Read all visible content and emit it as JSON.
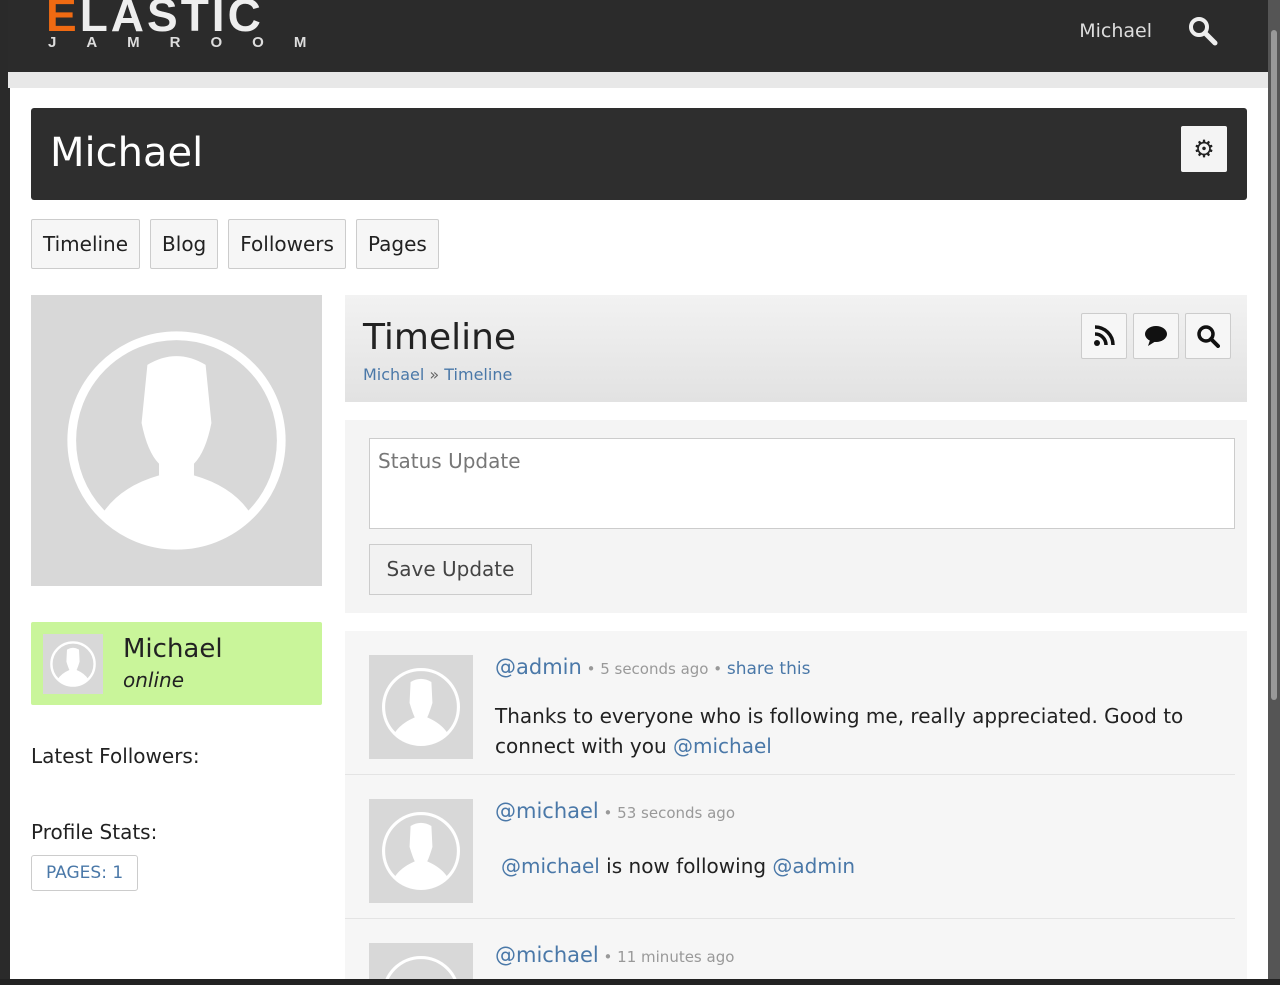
{
  "header": {
    "logo_main": "ELASTIC",
    "logo_sub": "JAMROOM",
    "user": "Michael"
  },
  "profile": {
    "name": "Michael"
  },
  "tabs": [
    "Timeline",
    "Blog",
    "Followers",
    "Pages"
  ],
  "sidebar": {
    "online_name": "Michael",
    "online_status": "online",
    "latest_followers": "Latest Followers:",
    "profile_stats": "Profile Stats:",
    "stat_badge": "PAGES: 1"
  },
  "timeline": {
    "title": "Timeline",
    "crumb_user": "Michael",
    "crumb_sep": "»",
    "crumb_page": "Timeline",
    "status_placeholder": "Status Update",
    "save_label": "Save Update"
  },
  "feed": [
    {
      "user": "@admin",
      "time": "5 seconds ago",
      "share": "share this",
      "text": "Thanks to everyone who is following me, really appreciated. Good to connect with you ",
      "mention": "@michael"
    },
    {
      "user": "@michael",
      "time": "53 seconds ago",
      "actor": "@michael",
      "text": " is now following ",
      "target": "@admin"
    },
    {
      "user": "@michael",
      "time": "11 minutes ago"
    }
  ]
}
